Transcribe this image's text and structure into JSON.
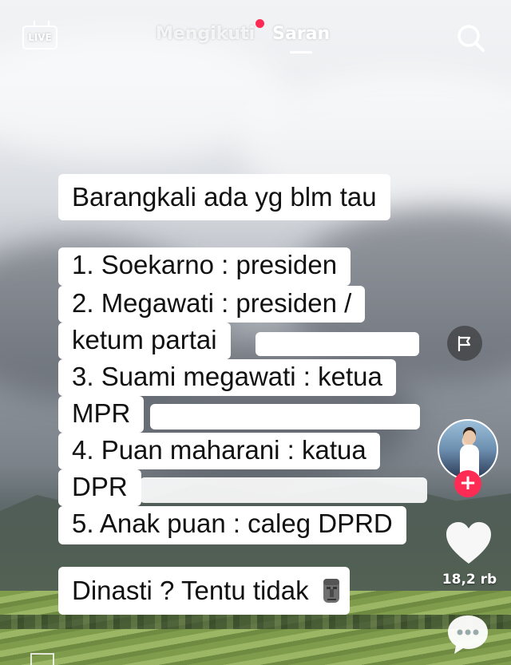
{
  "header": {
    "live_label": "LIVE",
    "tabs": [
      {
        "label": "Mengikuti",
        "has_notification_dot": true
      },
      {
        "label": "Saran",
        "active": true
      }
    ],
    "search_icon": "search-icon"
  },
  "captions": {
    "title": "Barangkali ada yg blm tau",
    "list": [
      "1. Soekarno : presiden",
      "2. Megawati : presiden /",
      "ketum partai",
      "3. Suami megawati : ketua",
      "MPR",
      "4. Puan maharani : katua",
      "DPR",
      "5. Anak puan : caleg DPRD"
    ],
    "closing": "Dinasti ? Tentu tidak",
    "closing_icon": "moai-emoji-icon"
  },
  "rail": {
    "report_icon": "flag-icon",
    "follow_label": "+",
    "like_count": "18,2 rb",
    "comment_icon": "comment-icon"
  },
  "colors": {
    "accent": "#fe2c55",
    "panel_bg": "#ffffff",
    "text": "#111111"
  }
}
